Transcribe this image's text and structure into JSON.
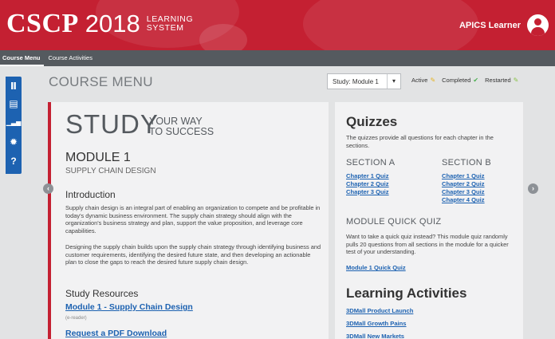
{
  "header": {
    "brand": {
      "cscp": "CSCP",
      "year": "2018",
      "sub_line1": "LEARNING",
      "sub_line2": "SYSTEM"
    },
    "user_name": "APICS Learner",
    "user_icon": "user-avatar-icon"
  },
  "subnav": {
    "tabs": [
      {
        "label": "Course Menu",
        "active": true
      },
      {
        "label": "Course Activities",
        "active": false
      }
    ]
  },
  "sidebar": {
    "items": [
      {
        "icon": "library-icon",
        "glyph": "Ⅱ"
      },
      {
        "icon": "notebook-icon",
        "glyph": "▤"
      },
      {
        "icon": "chart-icon",
        "glyph": "▁▃▅"
      },
      {
        "icon": "gear-icon",
        "glyph": "✹"
      },
      {
        "icon": "help-icon",
        "glyph": "?"
      }
    ]
  },
  "page": {
    "title": "COURSE MENU"
  },
  "module_select": {
    "value": "Study: Module 1",
    "caret": "▾"
  },
  "legend": [
    {
      "label": "Active",
      "icon": "pencil-icon",
      "glyph": "✎",
      "color": "#e6b422"
    },
    {
      "label": "Completed",
      "icon": "check-icon",
      "glyph": "✔",
      "color": "#4caf50"
    },
    {
      "label": "Restarted",
      "icon": "pencil-icon",
      "glyph": "✎",
      "color": "#8bc34a"
    }
  ],
  "study": {
    "headline": "STUDY",
    "tagline_1": "YOUR WAY",
    "tagline_2": "TO SUCCESS",
    "module_title": "MODULE 1",
    "module_subtitle": "SUPPLY CHAIN DESIGN",
    "intro_heading": "Introduction",
    "intro_p1": "Supply chain design is an integral part of enabling an organization to compete and be profitable in today's dynamic business environment. The supply chain strategy should align with the organization's business strategy and plan, support the value proposition, and leverage core capabilities.",
    "intro_p2": "Designing the supply chain builds upon the supply chain strategy through identifying business and customer requirements, identifying the desired future state, and then developing an actionable plan to close the gaps to reach the desired future supply chain design.",
    "resources_heading": "Study Resources",
    "resource_link": "Module 1 - Supply Chain Design",
    "resource_note": "(e-reader)",
    "pdf_link": "Request a PDF Download"
  },
  "quizzes": {
    "heading": "Quizzes",
    "intro": "The quizzes provide all questions for each chapter in the sections.",
    "section_a": {
      "label": "SECTION A",
      "quizzes": [
        "Chapter 1 Quiz",
        "Chapter 2 Quiz",
        "Chapter 3 Quiz"
      ]
    },
    "section_b": {
      "label": "SECTION B",
      "quizzes": [
        "Chapter 1 Quiz",
        "Chapter 2 Quiz",
        "Chapter 3 Quiz",
        "Chapter 4 Quiz"
      ]
    },
    "mqq_heading": "MODULE QUICK QUIZ",
    "mqq_text": "Want to take a quick quiz instead? This module quiz randomly pulls 20 questions from all sections in the module for a quicker test of your understanding.",
    "mqq_link": "Module 1 Quick Quiz"
  },
  "learning": {
    "heading": "Learning Activities",
    "activities": [
      "3DMall Product Launch",
      "3DMall Growth Pains",
      "3DMall New Markets"
    ]
  },
  "nav": {
    "prev": "‹",
    "next": "›"
  },
  "colors": {
    "brand_red": "#c42032",
    "brand_blue": "#1d62b1",
    "nav_gray": "#555a5f"
  }
}
